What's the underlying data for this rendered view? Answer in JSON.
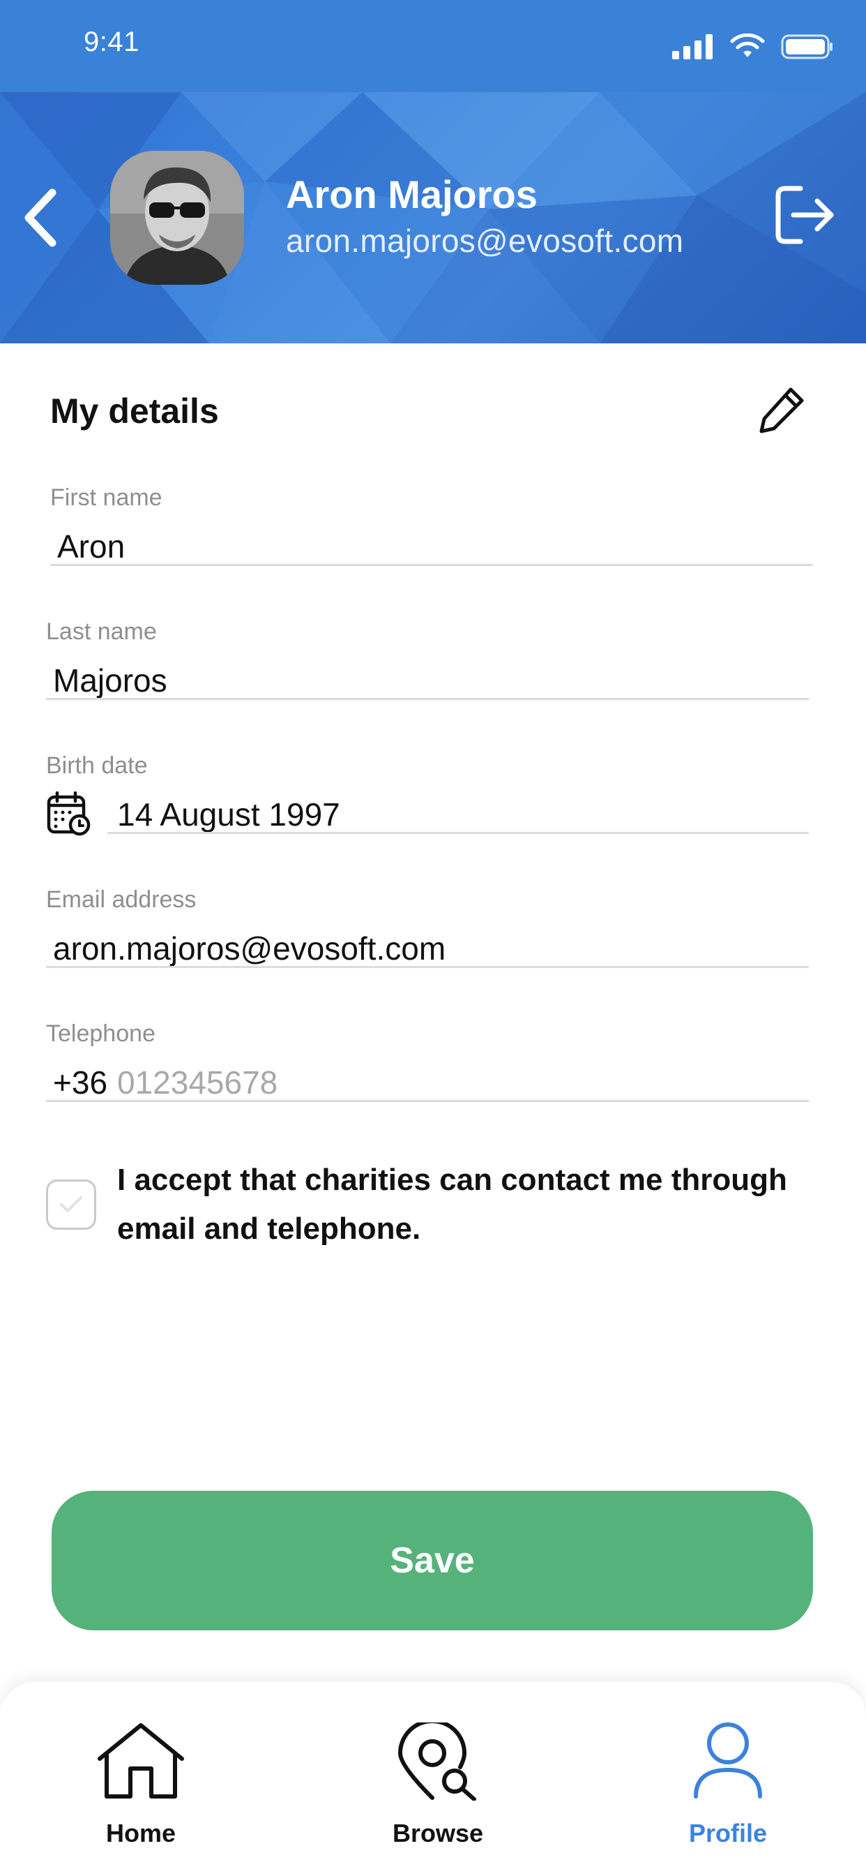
{
  "status_bar": {
    "time": "9:41"
  },
  "header": {
    "name": "Aron Majoros",
    "email": "aron.majoros@evosoft.com"
  },
  "details": {
    "title": "My details",
    "first_name": {
      "label": "First name",
      "value": "Aron"
    },
    "last_name": {
      "label": "Last name",
      "value": "Majoros"
    },
    "birth_date": {
      "label": "Birth date",
      "value": "14 August 1997"
    },
    "email": {
      "label": "Email address",
      "value": "aron.majoros@evosoft.com"
    },
    "telephone": {
      "label": "Telephone",
      "prefix": "+36",
      "placeholder": "012345678"
    },
    "consent": {
      "text": "I accept that charities can contact me through email and telephone.",
      "checked": false
    }
  },
  "save_label": "Save",
  "tabs": [
    {
      "label": "Home",
      "icon": "home-icon",
      "active": false
    },
    {
      "label": "Browse",
      "icon": "location-search-icon",
      "active": false
    },
    {
      "label": "Profile",
      "icon": "person-icon",
      "active": true
    }
  ],
  "colors": {
    "header_blue": "#3b82dc",
    "save_green": "#55b27a",
    "active_tab": "#3b82dc"
  }
}
